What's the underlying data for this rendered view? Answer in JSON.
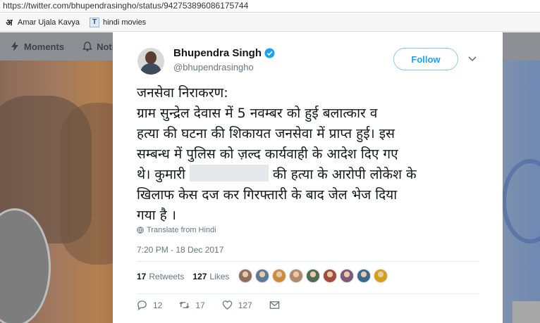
{
  "browser": {
    "url": "https://twitter.com/bhupendrasingho/status/942753896086175744",
    "bookmarks": [
      {
        "label": "Amar Ujala Kavya",
        "icon": "amar-ujala-icon"
      },
      {
        "label": "hindi movies",
        "icon": "hindi-movies-icon"
      }
    ]
  },
  "background_page": {
    "nav": [
      {
        "label": "Moments",
        "icon": "lightning-icon"
      },
      {
        "label": "Notifi",
        "icon": "bell-icon"
      }
    ]
  },
  "tweet": {
    "author_name": "Bhupendra Singh",
    "handle": "@bhupendrasingho",
    "verified": true,
    "follow_label": "Follow",
    "text_lines": [
      "जनसेवा निराकरण:",
      "ग्राम सुन्द्रेल देवास में 5 नवम्बर को हुई बलात्कार व",
      "हत्या की घटना की शिकायत जनसेवा में प्राप्त हुई। इस",
      "सम्बन्ध में पुलिस को ज़ल्द कार्यवाही के आदेश दिए गए",
      "थे। कुमारी",
      "की हत्या के आरोपी लोकेश के",
      "खिलाफ केस दज कर गिरफ्तारी के बाद जेल भेज दिया",
      "गया है ।"
    ],
    "translate_label": "Translate from Hindi",
    "timestamp": "7:20 PM - 18 Dec 2017",
    "retweets_count": "17",
    "retweets_label": "Retweets",
    "likes_count": "127",
    "likes_label": "Likes",
    "liker_colors": [
      "#8d6e63",
      "#5d7a99",
      "#c98d3c",
      "#b08a6e",
      "#4f6d52",
      "#a24c3b",
      "#7d5a7a",
      "#3b6a8f",
      "#d4a017"
    ],
    "actions": {
      "reply_count": "12",
      "retweet_count": "17",
      "like_count": "127"
    },
    "accent_color": "#1da1f2"
  }
}
